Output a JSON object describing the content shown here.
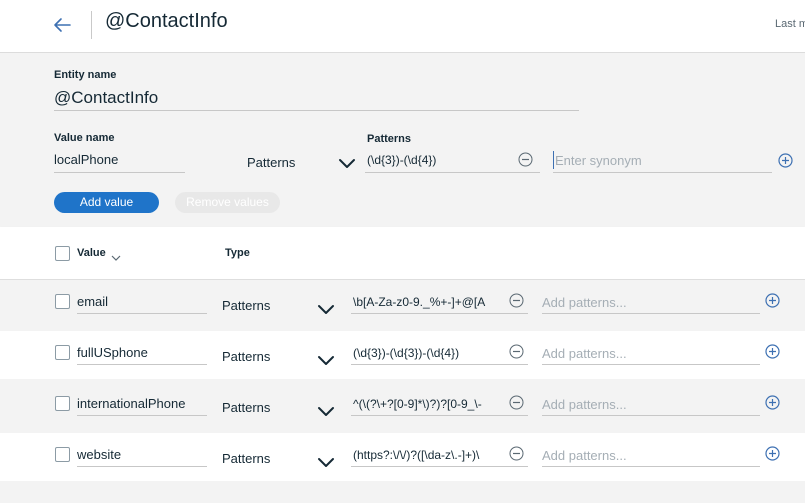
{
  "header": {
    "title": "@ContactInfo",
    "last_modified": "Last m"
  },
  "form": {
    "entity_name_label": "Entity name",
    "entity_name_value": "@ContactInfo",
    "value_name_label": "Value name",
    "value_name_value": "localPhone",
    "type_value": "Patterns",
    "patterns_label": "Patterns",
    "pattern_value": "(\\d{3})-(\\d{4})",
    "synonym_placeholder": "Enter synonym",
    "add_value_label": "Add value",
    "remove_values_label": "Remove values"
  },
  "table": {
    "col_value": "Value",
    "col_type": "Type",
    "pattern_placeholder": "Add patterns...",
    "rows": [
      {
        "value": "email",
        "type": "Patterns",
        "pattern": "\\b[A-Za-z0-9._%+-]+@[A"
      },
      {
        "value": "fullUSphone",
        "type": "Patterns",
        "pattern": "(\\d{3})-(\\d{3})-(\\d{4})"
      },
      {
        "value": "internationalPhone",
        "type": "Patterns",
        "pattern": "^(\\(?\\+?[0-9]*\\)?)?[0-9_\\-"
      },
      {
        "value": "website",
        "type": "Patterns",
        "pattern": "(https?:\\/\\/)?([\\da-z\\.-]+)\\"
      }
    ]
  },
  "colors": {
    "accent": "#1f74c9",
    "icon_blue": "#3d70b2",
    "text": "#152935",
    "placeholder": "#a5aeb5"
  },
  "icons": {
    "back": "arrow-left-icon",
    "chevron": "chevron-down-icon",
    "remove": "minus-circle-icon",
    "add": "plus-circle-icon"
  }
}
